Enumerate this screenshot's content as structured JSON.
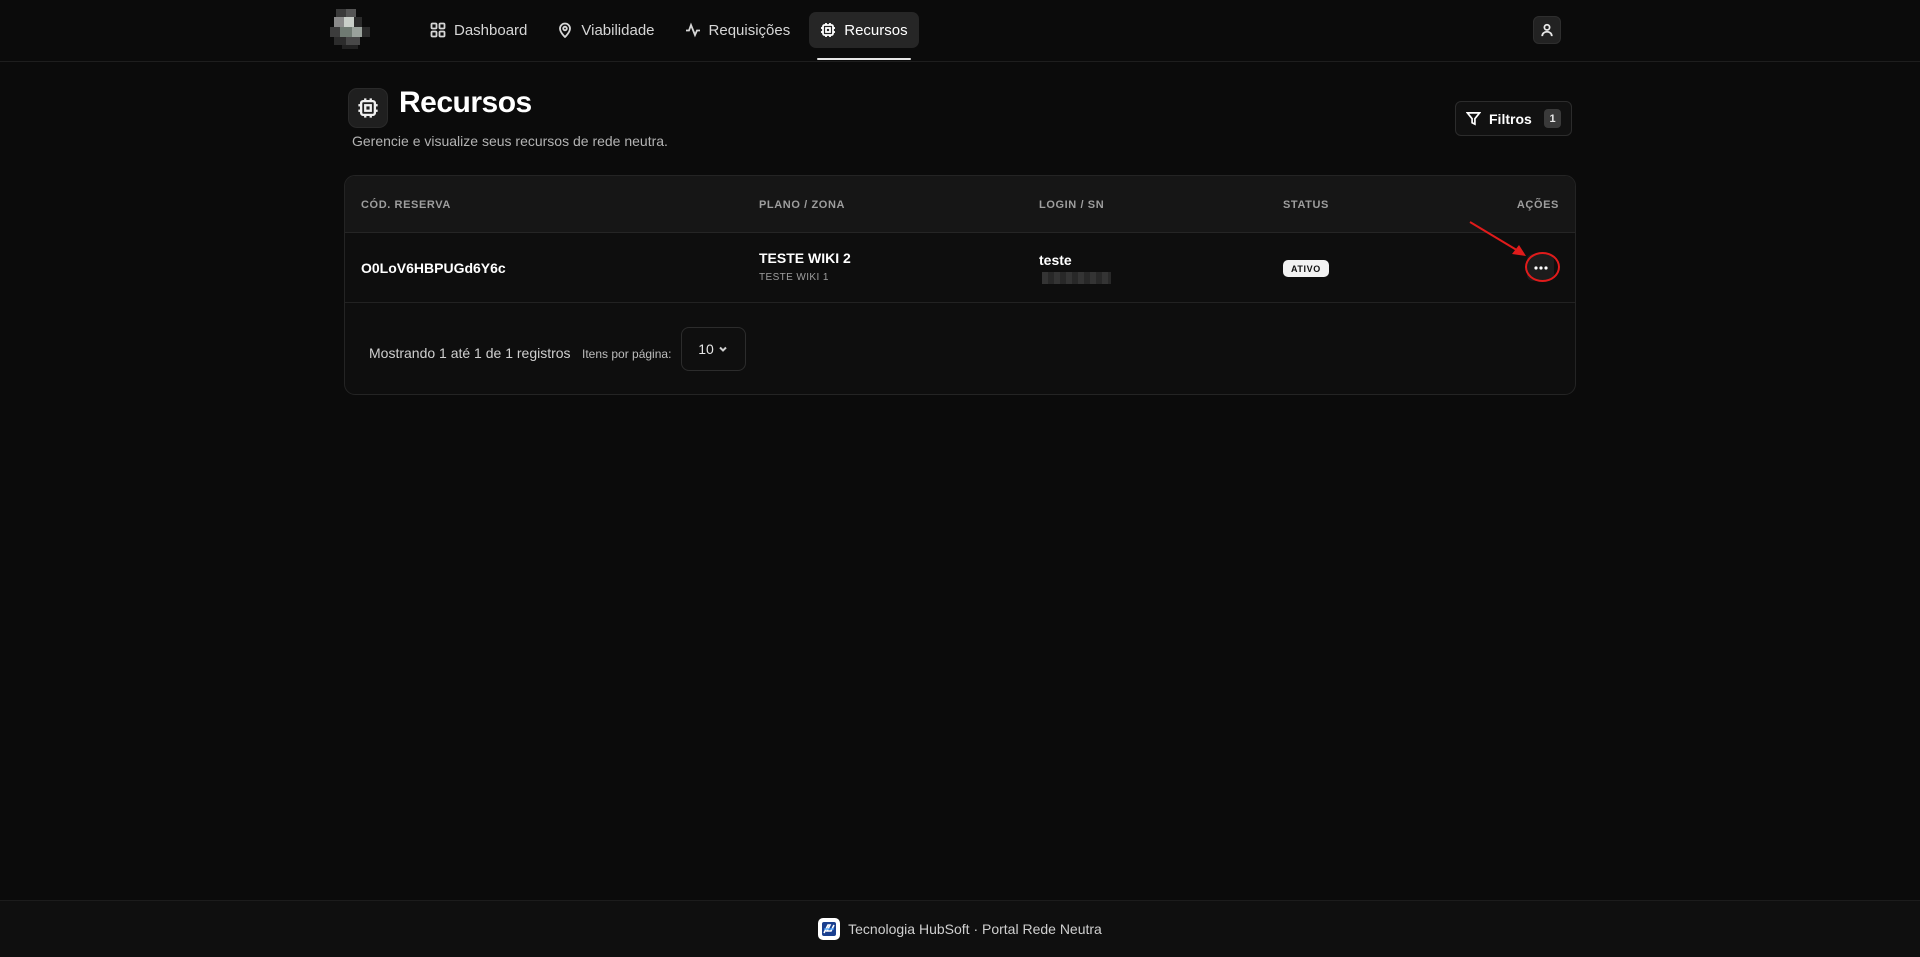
{
  "nav": {
    "items": [
      {
        "label": "Dashboard",
        "icon": "grid-icon"
      },
      {
        "label": "Viabilidade",
        "icon": "map-pin-icon"
      },
      {
        "label": "Requisições",
        "icon": "activity-icon"
      },
      {
        "label": "Recursos",
        "icon": "chip-icon",
        "active": true
      }
    ],
    "user_icon": "user-icon"
  },
  "header": {
    "title": "Recursos",
    "subtitle": "Gerencie e visualize seus recursos de rede neutra.",
    "filters_label": "Filtros",
    "filters_count": "1"
  },
  "table": {
    "columns": {
      "code": "CÓD. RESERVA",
      "plan": "PLANO / ZONA",
      "login": "LOGIN / SN",
      "status": "STATUS",
      "actions": "AÇÕES"
    },
    "rows": [
      {
        "code": "O0LoV6HBPUGd6Y6c",
        "plan": "TESTE WIKI 2",
        "zone": "TESTE WIKI 1",
        "login": "teste",
        "status": "ATIVO"
      }
    ]
  },
  "pagination": {
    "showing": "Mostrando 1 até 1 de 1 registros",
    "per_page_label": "Itens por página:",
    "per_page_value": "10"
  },
  "footer": {
    "text": "Tecnologia HubSoft · Portal Rede Neutra"
  },
  "colors": {
    "background": "#0b0b0b",
    "annotation": "#e01b1b",
    "status_badge": "#f2f2f2"
  }
}
